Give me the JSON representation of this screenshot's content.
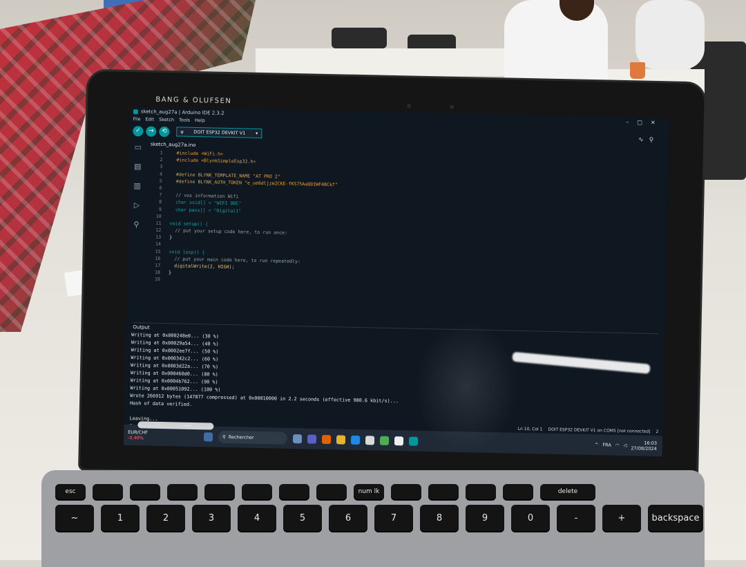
{
  "lid": {
    "brand": "BANG & OLUFSEN"
  },
  "window": {
    "title": "sketch_aug27a | Arduino IDE 2.3.2",
    "menu": [
      "File",
      "Edit",
      "Sketch",
      "Tools",
      "Help"
    ],
    "board_select": "DOIT ESP32 DEVKIT V1",
    "file_tab": "sketch_aug27a.ino"
  },
  "editor": {
    "lines": [
      {
        "n": "1",
        "t": "  #include <WiFi.h>"
      },
      {
        "n": "2",
        "t": "  #include <BlynkSimpleEsp32.h>"
      },
      {
        "n": "3",
        "t": ""
      },
      {
        "n": "4",
        "t": "  #define BLYNK_TEMPLATE_NAME \"AT PRO 2\""
      },
      {
        "n": "5",
        "t": "  #define BLYNK_AUTH_TOKEN \"e_ue6dljzm2CKE-fKS75AaQ0IWF4BCkf\""
      },
      {
        "n": "6",
        "t": ""
      },
      {
        "n": "7",
        "t": "  // vos information Wifi"
      },
      {
        "n": "8",
        "t": "  char ssid[] = \"WIFI ODC\""
      },
      {
        "n": "9",
        "t": "  char pass[] = \"Digital1\""
      },
      {
        "n": "10",
        "t": ""
      },
      {
        "n": "11",
        "t": "void setup() {"
      },
      {
        "n": "12",
        "t": "  // put your setup code here, to run once:"
      },
      {
        "n": "13",
        "t": "}"
      },
      {
        "n": "14",
        "t": ""
      },
      {
        "n": "15",
        "t": "void loop() {"
      },
      {
        "n": "16",
        "t": "  // put your main code here, to run repeatedly:"
      },
      {
        "n": "17",
        "t": "  digitalWrite(2, HIGH);"
      },
      {
        "n": "18",
        "t": "}"
      },
      {
        "n": "19",
        "t": ""
      }
    ]
  },
  "output": {
    "heading": "Output",
    "lines": [
      "Writing at 0x000248e0... (30 %)",
      "Writing at 0x00029a54... (40 %)",
      "Writing at 0x0002ee7f... (50 %)",
      "Writing at 0x000342c2... (60 %)",
      "Writing at 0x0003d22a... (70 %)",
      "Writing at 0x000460d0... (80 %)",
      "Writing at 0x0004b762... (90 %)",
      "Writing at 0x00051092... (100 %)",
      "Wrote 266912 bytes (147877 compressed) at 0x00010000 in 2.2 seconds (effective 980.6 kbit/s)...",
      "Hash of data verified.",
      "",
      "Leaving...",
      "Hard resetting via RTS pin..."
    ]
  },
  "statusbar": {
    "position": "Ln 10, Col 1",
    "board": "DOIT ESP32 DEVKIT V1 on COM5 [not connected]",
    "notifications": "2"
  },
  "taskbar": {
    "widget_name": "EUR/CHF",
    "widget_value": "-0,48%",
    "search": "Rechercher",
    "lang": "FRA",
    "time": "16:03",
    "date": "27/08/2024"
  },
  "keyboard": {
    "frow": [
      "esc",
      "",
      "",
      "",
      "",
      "",
      "",
      "",
      "num lk",
      "",
      "",
      "",
      "",
      "delete"
    ],
    "nrow": [
      "~",
      "1",
      "2",
      "3",
      "4",
      "5",
      "6",
      "7",
      "8",
      "9",
      "0",
      "-",
      "+",
      "backspace"
    ]
  }
}
